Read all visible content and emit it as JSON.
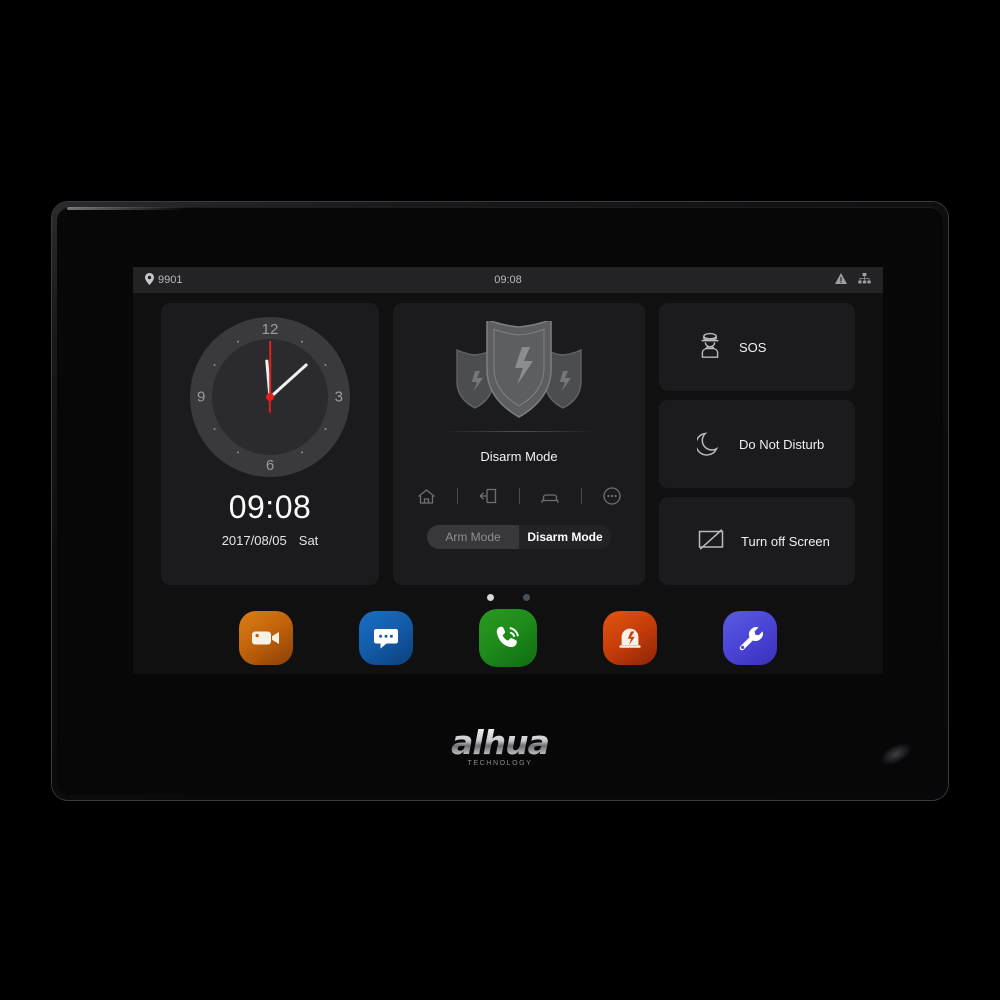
{
  "device": {
    "brand_logo": "alhua",
    "brand_sub": "TECHNOLOGY"
  },
  "statusbar": {
    "location_icon": "location-pin-icon",
    "room_number": "9901",
    "time": "09:08",
    "warning_icon": "warning-triangle-icon",
    "network_icon": "network-tree-icon"
  },
  "clock_widget": {
    "numerals": {
      "n12": "12",
      "n3": "3",
      "n6": "6",
      "n9": "9"
    },
    "digital_time": "09:08",
    "date": "2017/08/05",
    "weekday": "Sat",
    "second_hand_color": "#e02020"
  },
  "arm_widget": {
    "shield_icon": "shield-bolt-icon",
    "mode_label": "Disarm Mode",
    "mode_icons": [
      {
        "name": "home-mode-icon",
        "label": "Home"
      },
      {
        "name": "away-mode-icon",
        "label": "Away"
      },
      {
        "name": "sleep-mode-icon",
        "label": "Sleep"
      },
      {
        "name": "more-modes-icon",
        "label": "More"
      }
    ],
    "toggle": {
      "arm_label": "Arm Mode",
      "disarm_label": "Disarm Mode",
      "selected": "Disarm Mode"
    }
  },
  "actions": [
    {
      "label": "SOS",
      "icon": "guard-officer-icon"
    },
    {
      "label": "Do Not Disturb",
      "icon": "moon-icon"
    },
    {
      "label": "Turn off Screen",
      "icon": "screen-off-icon"
    }
  ],
  "pager": {
    "pages": 2,
    "active": 1
  },
  "dock": [
    {
      "label": "Monitor",
      "icon": "video-camera-icon",
      "color": "#c4640c"
    },
    {
      "label": "Message",
      "icon": "message-bubble-icon",
      "color": "#135ba8"
    },
    {
      "label": "Call",
      "icon": "phone-call-icon",
      "color": "#1d8a1a"
    },
    {
      "label": "Alarm",
      "icon": "alarm-siren-icon",
      "color": "#c53c0a"
    },
    {
      "label": "Settings",
      "icon": "wrench-icon",
      "color": "#4a44d6"
    }
  ]
}
